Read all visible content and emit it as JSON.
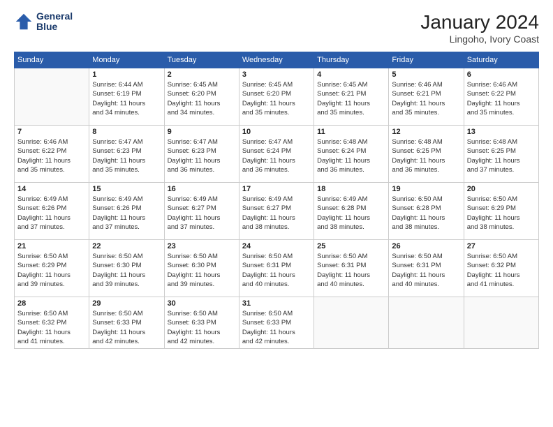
{
  "header": {
    "logo_line1": "General",
    "logo_line2": "Blue",
    "month_year": "January 2024",
    "location": "Lingoho, Ivory Coast"
  },
  "weekdays": [
    "Sunday",
    "Monday",
    "Tuesday",
    "Wednesday",
    "Thursday",
    "Friday",
    "Saturday"
  ],
  "weeks": [
    [
      {
        "day": "",
        "sunrise": "",
        "sunset": "",
        "daylight": ""
      },
      {
        "day": "1",
        "sunrise": "6:44 AM",
        "sunset": "6:19 PM",
        "daylight": "11 hours and 34 minutes."
      },
      {
        "day": "2",
        "sunrise": "6:45 AM",
        "sunset": "6:20 PM",
        "daylight": "11 hours and 34 minutes."
      },
      {
        "day": "3",
        "sunrise": "6:45 AM",
        "sunset": "6:20 PM",
        "daylight": "11 hours and 35 minutes."
      },
      {
        "day": "4",
        "sunrise": "6:45 AM",
        "sunset": "6:21 PM",
        "daylight": "11 hours and 35 minutes."
      },
      {
        "day": "5",
        "sunrise": "6:46 AM",
        "sunset": "6:21 PM",
        "daylight": "11 hours and 35 minutes."
      },
      {
        "day": "6",
        "sunrise": "6:46 AM",
        "sunset": "6:22 PM",
        "daylight": "11 hours and 35 minutes."
      }
    ],
    [
      {
        "day": "7",
        "sunrise": "6:46 AM",
        "sunset": "6:22 PM",
        "daylight": "11 hours and 35 minutes."
      },
      {
        "day": "8",
        "sunrise": "6:47 AM",
        "sunset": "6:23 PM",
        "daylight": "11 hours and 35 minutes."
      },
      {
        "day": "9",
        "sunrise": "6:47 AM",
        "sunset": "6:23 PM",
        "daylight": "11 hours and 36 minutes."
      },
      {
        "day": "10",
        "sunrise": "6:47 AM",
        "sunset": "6:24 PM",
        "daylight": "11 hours and 36 minutes."
      },
      {
        "day": "11",
        "sunrise": "6:48 AM",
        "sunset": "6:24 PM",
        "daylight": "11 hours and 36 minutes."
      },
      {
        "day": "12",
        "sunrise": "6:48 AM",
        "sunset": "6:25 PM",
        "daylight": "11 hours and 36 minutes."
      },
      {
        "day": "13",
        "sunrise": "6:48 AM",
        "sunset": "6:25 PM",
        "daylight": "11 hours and 37 minutes."
      }
    ],
    [
      {
        "day": "14",
        "sunrise": "6:49 AM",
        "sunset": "6:26 PM",
        "daylight": "11 hours and 37 minutes."
      },
      {
        "day": "15",
        "sunrise": "6:49 AM",
        "sunset": "6:26 PM",
        "daylight": "11 hours and 37 minutes."
      },
      {
        "day": "16",
        "sunrise": "6:49 AM",
        "sunset": "6:27 PM",
        "daylight": "11 hours and 37 minutes."
      },
      {
        "day": "17",
        "sunrise": "6:49 AM",
        "sunset": "6:27 PM",
        "daylight": "11 hours and 38 minutes."
      },
      {
        "day": "18",
        "sunrise": "6:49 AM",
        "sunset": "6:28 PM",
        "daylight": "11 hours and 38 minutes."
      },
      {
        "day": "19",
        "sunrise": "6:50 AM",
        "sunset": "6:28 PM",
        "daylight": "11 hours and 38 minutes."
      },
      {
        "day": "20",
        "sunrise": "6:50 AM",
        "sunset": "6:29 PM",
        "daylight": "11 hours and 38 minutes."
      }
    ],
    [
      {
        "day": "21",
        "sunrise": "6:50 AM",
        "sunset": "6:29 PM",
        "daylight": "11 hours and 39 minutes."
      },
      {
        "day": "22",
        "sunrise": "6:50 AM",
        "sunset": "6:30 PM",
        "daylight": "11 hours and 39 minutes."
      },
      {
        "day": "23",
        "sunrise": "6:50 AM",
        "sunset": "6:30 PM",
        "daylight": "11 hours and 39 minutes."
      },
      {
        "day": "24",
        "sunrise": "6:50 AM",
        "sunset": "6:31 PM",
        "daylight": "11 hours and 40 minutes."
      },
      {
        "day": "25",
        "sunrise": "6:50 AM",
        "sunset": "6:31 PM",
        "daylight": "11 hours and 40 minutes."
      },
      {
        "day": "26",
        "sunrise": "6:50 AM",
        "sunset": "6:31 PM",
        "daylight": "11 hours and 40 minutes."
      },
      {
        "day": "27",
        "sunrise": "6:50 AM",
        "sunset": "6:32 PM",
        "daylight": "11 hours and 41 minutes."
      }
    ],
    [
      {
        "day": "28",
        "sunrise": "6:50 AM",
        "sunset": "6:32 PM",
        "daylight": "11 hours and 41 minutes."
      },
      {
        "day": "29",
        "sunrise": "6:50 AM",
        "sunset": "6:33 PM",
        "daylight": "11 hours and 42 minutes."
      },
      {
        "day": "30",
        "sunrise": "6:50 AM",
        "sunset": "6:33 PM",
        "daylight": "11 hours and 42 minutes."
      },
      {
        "day": "31",
        "sunrise": "6:50 AM",
        "sunset": "6:33 PM",
        "daylight": "11 hours and 42 minutes."
      },
      {
        "day": "",
        "sunrise": "",
        "sunset": "",
        "daylight": ""
      },
      {
        "day": "",
        "sunrise": "",
        "sunset": "",
        "daylight": ""
      },
      {
        "day": "",
        "sunrise": "",
        "sunset": "",
        "daylight": ""
      }
    ]
  ],
  "labels": {
    "sunrise_prefix": "Sunrise: ",
    "sunset_prefix": "Sunset: ",
    "daylight_prefix": "Daylight: "
  }
}
